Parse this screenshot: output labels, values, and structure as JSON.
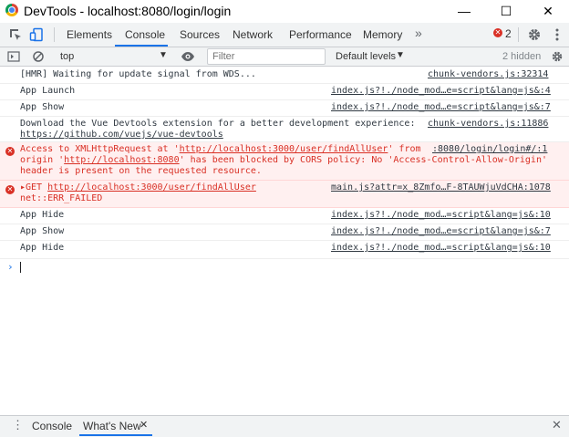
{
  "window": {
    "title": "DevTools - localhost:8080/login/login",
    "minimize": "—",
    "maximize": "☐",
    "close": "✕"
  },
  "tabs": [
    {
      "label": "Elements"
    },
    {
      "label": "Console"
    },
    {
      "label": "Sources"
    },
    {
      "label": "Network"
    },
    {
      "label": "Performance"
    },
    {
      "label": "Memory"
    }
  ],
  "tabs_more": "»",
  "error_count": "2",
  "toolbar": {
    "context": "top",
    "filter_placeholder": "Filter",
    "levels": "Default levels",
    "hidden": "2 hidden"
  },
  "logs": [
    {
      "text": "[HMR] Waiting for update signal from WDS...",
      "source": "chunk-vendors.js:32314"
    },
    {
      "text": "App Launch",
      "source": "index.js?!./node_mod…e=script&lang=js&:4"
    },
    {
      "text": "App Show",
      "source": "index.js?!./node_mod…e=script&lang=js&:7"
    },
    {
      "text": "Download the Vue Devtools extension for a better development experience:",
      "link": "https://github.com/vuejs/vue-devtools",
      "source": "chunk-vendors.js:11886"
    },
    {
      "level": "error",
      "line1a": "Access to XMLHttpRequest at '",
      "line1link": "http://localhost:3000/user/findAllUser",
      "line1b": "' from",
      "line2a": "origin '",
      "line2link": "http://localhost:8080",
      "line2b": "' has been blocked by CORS policy: No 'Access-Control-Allow-Origin'",
      "line3": "header is present on the requested resource.",
      "source": ":8080/login/login#/:1"
    },
    {
      "level": "error",
      "prefix": "▸GET ",
      "link": "http://localhost:3000/user/findAllUser",
      "line2": "net::ERR_FAILED",
      "source": "main.js?attr=x_8Zmfo…F-8TAUWjuVdCHA:1078"
    },
    {
      "text": "App Hide",
      "source": "index.js?!./node_mod…=script&lang=js&:10"
    },
    {
      "text": "App Show",
      "source": "index.js?!./node_mod…e=script&lang=js&:7"
    },
    {
      "text": "App Hide",
      "source": "index.js?!./node_mod…=script&lang=js&:10"
    }
  ],
  "prompt": "›",
  "drawer": {
    "menu": "⋮",
    "tabs": [
      {
        "label": "Console"
      },
      {
        "label": "What's New"
      }
    ],
    "tab_close": "✕",
    "close": "✕"
  }
}
